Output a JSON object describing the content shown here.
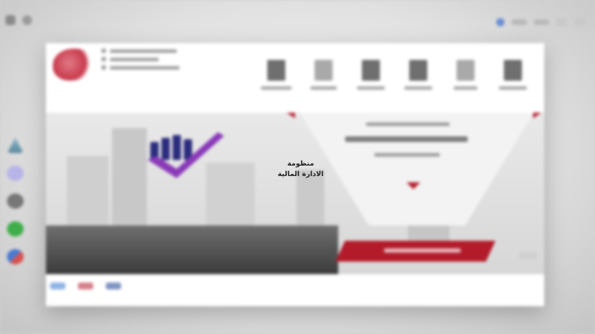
{
  "app": {
    "title_line1": "منظومة",
    "title_line2": "الادارة المالية"
  },
  "colors": {
    "accent_red": "#b31b2a",
    "brand_purple": "#8a3ab9",
    "brand_navy": "#2c2c7e"
  },
  "icons": {
    "dock": [
      "drive-icon",
      "app-icon",
      "settings-icon",
      "chat-icon",
      "browser-icon"
    ],
    "toolbar": [
      "toolbar-icon-1",
      "toolbar-icon-2",
      "toolbar-icon-3",
      "toolbar-icon-4",
      "toolbar-icon-5",
      "toolbar-icon-6"
    ]
  }
}
